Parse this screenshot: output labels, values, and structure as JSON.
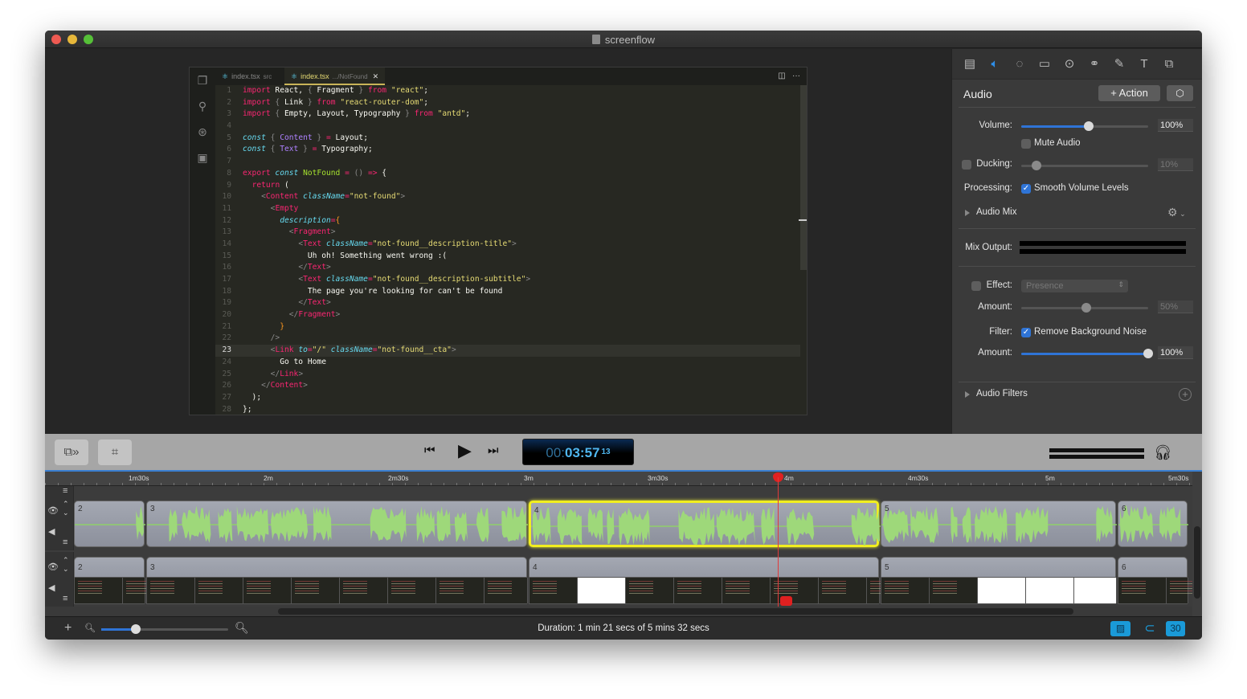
{
  "window": {
    "title": "screenflow"
  },
  "editor": {
    "tabs": [
      {
        "label": "index.tsx",
        "sub": "src",
        "active": false
      },
      {
        "label": "index.tsx",
        "sub": ".../NotFound",
        "active": true
      }
    ],
    "activity_icons": [
      "files-icon",
      "search-icon",
      "debug-icon",
      "extensions-icon"
    ],
    "current_line": 23,
    "lines": [
      [
        [
          "k",
          "import"
        ],
        [
          "t",
          " React, "
        ],
        [
          "d",
          "{"
        ],
        [
          "t",
          " Fragment "
        ],
        [
          "d",
          "}"
        ],
        [
          "k",
          " from "
        ],
        [
          "s",
          "\"react\""
        ],
        [
          "t",
          ";"
        ]
      ],
      [
        [
          "k",
          "import"
        ],
        [
          "d",
          " {"
        ],
        [
          "t",
          " Link "
        ],
        [
          "d",
          "}"
        ],
        [
          "k",
          " from "
        ],
        [
          "s",
          "\"react-router-dom\""
        ],
        [
          "t",
          ";"
        ]
      ],
      [
        [
          "k",
          "import"
        ],
        [
          "d",
          " {"
        ],
        [
          "t",
          " Empty, Layout, Typography "
        ],
        [
          "d",
          "}"
        ],
        [
          "k",
          " from "
        ],
        [
          "s",
          "\"antd\""
        ],
        [
          "t",
          ";"
        ]
      ],
      [],
      [
        [
          "i",
          "const"
        ],
        [
          "d",
          " { "
        ],
        [
          "v",
          "Content"
        ],
        [
          "d",
          " } "
        ],
        [
          "k",
          "="
        ],
        [
          "t",
          " Layout;"
        ]
      ],
      [
        [
          "i",
          "const"
        ],
        [
          "d",
          " { "
        ],
        [
          "v",
          "Text"
        ],
        [
          "d",
          " } "
        ],
        [
          "k",
          "="
        ],
        [
          "t",
          " Typography;"
        ]
      ],
      [],
      [
        [
          "k",
          "export"
        ],
        [
          "i",
          " const"
        ],
        [
          "g",
          " NotFound"
        ],
        [
          "k",
          " ="
        ],
        [
          "d",
          " () "
        ],
        [
          "k",
          "=>"
        ],
        [
          "t",
          " {"
        ]
      ],
      [
        [
          "t",
          "  "
        ],
        [
          "k",
          "return"
        ],
        [
          "t",
          " ("
        ]
      ],
      [
        [
          "t",
          "    "
        ],
        [
          "d",
          "<"
        ],
        [
          "k",
          "Content"
        ],
        [
          "i",
          " className"
        ],
        [
          "k",
          "="
        ],
        [
          "s",
          "\"not-found\""
        ],
        [
          "d",
          ">"
        ]
      ],
      [
        [
          "t",
          "      "
        ],
        [
          "d",
          "<"
        ],
        [
          "k",
          "Empty"
        ]
      ],
      [
        [
          "t",
          "        "
        ],
        [
          "i",
          "description"
        ],
        [
          "k",
          "="
        ],
        [
          "o",
          "{"
        ]
      ],
      [
        [
          "t",
          "          "
        ],
        [
          "d",
          "<"
        ],
        [
          "k",
          "Fragment"
        ],
        [
          "d",
          ">"
        ]
      ],
      [
        [
          "t",
          "            "
        ],
        [
          "d",
          "<"
        ],
        [
          "k",
          "Text"
        ],
        [
          "i",
          " className"
        ],
        [
          "k",
          "="
        ],
        [
          "s",
          "\"not-found__description-title\""
        ],
        [
          "d",
          ">"
        ]
      ],
      [
        [
          "t",
          "              Uh oh! Something went wrong :("
        ]
      ],
      [
        [
          "t",
          "            "
        ],
        [
          "d",
          "</"
        ],
        [
          "k",
          "Text"
        ],
        [
          "d",
          ">"
        ]
      ],
      [
        [
          "t",
          "            "
        ],
        [
          "d",
          "<"
        ],
        [
          "k",
          "Text"
        ],
        [
          "i",
          " className"
        ],
        [
          "k",
          "="
        ],
        [
          "s",
          "\"not-found__description-subtitle\""
        ],
        [
          "d",
          ">"
        ]
      ],
      [
        [
          "t",
          "              The page you're looking for can't be found"
        ]
      ],
      [
        [
          "t",
          "            "
        ],
        [
          "d",
          "</"
        ],
        [
          "k",
          "Text"
        ],
        [
          "d",
          ">"
        ]
      ],
      [
        [
          "t",
          "          "
        ],
        [
          "d",
          "</"
        ],
        [
          "k",
          "Fragment"
        ],
        [
          "d",
          ">"
        ]
      ],
      [
        [
          "t",
          "        "
        ],
        [
          "o",
          "}"
        ]
      ],
      [
        [
          "t",
          "      "
        ],
        [
          "d",
          "/>"
        ]
      ],
      [
        [
          "t",
          "      "
        ],
        [
          "d",
          "<"
        ],
        [
          "k",
          "Link"
        ],
        [
          "i",
          " to"
        ],
        [
          "k",
          "="
        ],
        [
          "s",
          "\"/\""
        ],
        [
          "i",
          " className"
        ],
        [
          "k",
          "="
        ],
        [
          "s",
          "\"not-found__cta\""
        ],
        [
          "d",
          ">"
        ]
      ],
      [
        [
          "t",
          "        Go to Home"
        ]
      ],
      [
        [
          "t",
          "      "
        ],
        [
          "d",
          "</"
        ],
        [
          "k",
          "Link"
        ],
        [
          "d",
          ">"
        ]
      ],
      [
        [
          "t",
          "    "
        ],
        [
          "d",
          "</"
        ],
        [
          "k",
          "Content"
        ],
        [
          "d",
          ">"
        ]
      ],
      [
        [
          "t",
          "  );"
        ]
      ],
      [
        [
          "t",
          "};"
        ]
      ]
    ]
  },
  "inspector": {
    "tool_icons": [
      "video-icon",
      "audio-icon",
      "video-motion-icon",
      "screen-recording-icon",
      "callout-icon",
      "filter-icon",
      "annotation-icon",
      "text-icon",
      "media-icon"
    ],
    "active_tool": 1,
    "heading": "Audio",
    "action_button": "+ Action",
    "volume": {
      "label": "Volume:",
      "value": "100%",
      "level": 0.53
    },
    "mute": {
      "label": "Mute Audio",
      "checked": false
    },
    "ducking": {
      "label": "Ducking:",
      "value": "10%",
      "level": 0.12,
      "checked": false
    },
    "processing": {
      "label": "Processing:",
      "option": "Smooth Volume Levels",
      "checked": true
    },
    "audio_mix": {
      "label": "Audio Mix"
    },
    "mix_output": {
      "label": "Mix Output:"
    },
    "effect": {
      "label": "Effect:",
      "value": "Presence",
      "checked": false
    },
    "effect_amount": {
      "label": "Amount:",
      "value": "50%",
      "level": 0.51
    },
    "filter": {
      "label": "Filter:",
      "option": "Remove Background Noise",
      "checked": true
    },
    "filter_amount": {
      "label": "Amount:",
      "value": "100%",
      "level": 1.0
    },
    "audio_filters": {
      "label": "Audio Filters"
    }
  },
  "transport": {
    "timecode_dim": "00:",
    "timecode": "03:57",
    "frames": "13"
  },
  "timeline": {
    "ruler": [
      "1m30s",
      "2m",
      "2m30s",
      "3m",
      "3m30s",
      "4m",
      "4m30s",
      "5m",
      "5m30s"
    ],
    "audio_clips": [
      "2",
      "3",
      "4",
      "5",
      "6"
    ],
    "video_clips": [
      "2",
      "3",
      "4",
      "5",
      "6"
    ],
    "selected_clip": "4"
  },
  "bottom": {
    "duration": "Duration: 1 min 21 secs of 5 mins 32 secs",
    "fps": "30"
  }
}
